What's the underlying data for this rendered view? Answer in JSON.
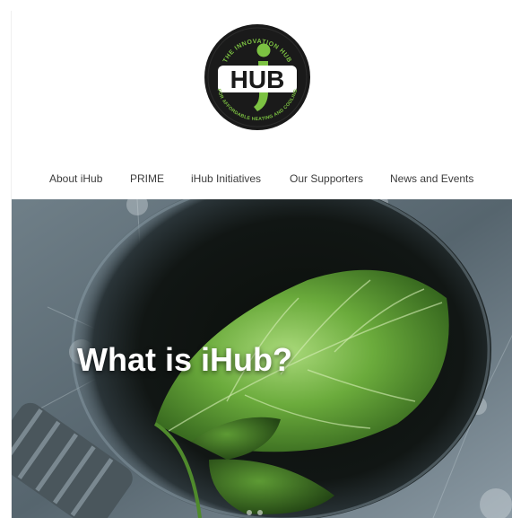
{
  "logo": {
    "top_text": "THE INNOVATION HUB",
    "main_text": "HUB",
    "bottom_text": "FOR AFFORDABLE HEATING AND COOLING"
  },
  "nav": {
    "items": [
      {
        "label": "About iHub"
      },
      {
        "label": "PRIME"
      },
      {
        "label": "iHub Initiatives"
      },
      {
        "label": "Our Supporters"
      },
      {
        "label": "News and Events"
      }
    ]
  },
  "hero": {
    "title": "What is iHub?"
  },
  "colors": {
    "brand_green": "#7cc242",
    "logo_black": "#1a1a1a",
    "nav_text": "#3c3c3c"
  }
}
